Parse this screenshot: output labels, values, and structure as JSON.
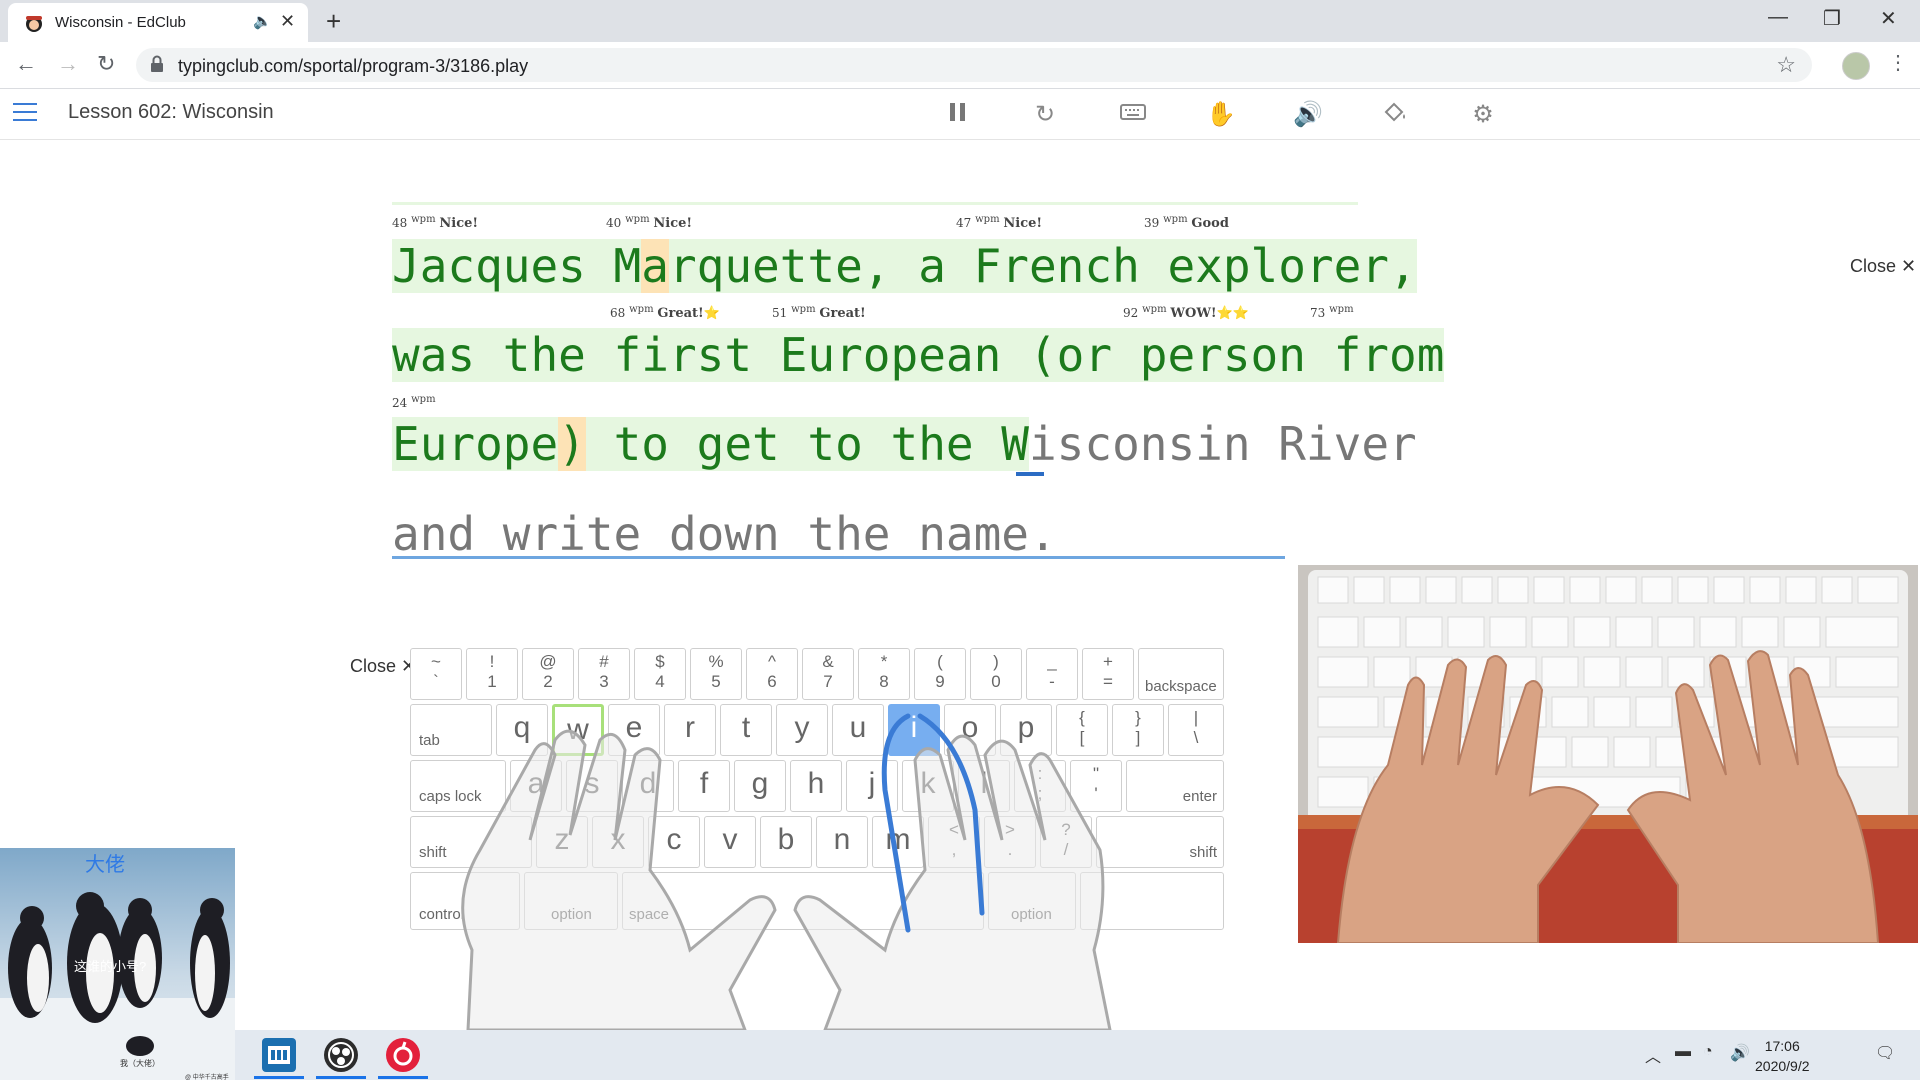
{
  "browser": {
    "tab_title": "Wisconsin - EdClub",
    "url": "typingclub.com/sportal/program-3/3186.play"
  },
  "app": {
    "lesson_title": "Lesson 602: Wisconsin",
    "close_label": "Close",
    "toolbar_icons": [
      "pause-icon",
      "restart-icon",
      "keyboard-icon",
      "hand-icon",
      "sound-icon",
      "theme-icon",
      "settings-icon"
    ]
  },
  "text": {
    "line1": {
      "wpm": [
        {
          "n": "48",
          "unit": "wpm",
          "rating": "Nice!"
        },
        {
          "n": "40",
          "unit": "wpm",
          "rating": "Nice!"
        },
        {
          "n": "47",
          "unit": "wpm",
          "rating": "Nice!"
        },
        {
          "n": "39",
          "unit": "wpm",
          "rating": "Good"
        }
      ],
      "seg1": "Jacques M",
      "err": "a",
      "seg2": "rquette, a French explorer,"
    },
    "line2": {
      "wpm": [
        {
          "n": "68",
          "unit": "wpm",
          "rating": "Great!⭐"
        },
        {
          "n": "51",
          "unit": "wpm",
          "rating": "Great!"
        },
        {
          "n": "92",
          "unit": "wpm",
          "rating": "WOW!⭐⭐"
        },
        {
          "n": "73",
          "unit": "wpm",
          "rating": ""
        }
      ],
      "text": "was the first European (or person from"
    },
    "line3": {
      "wpm": [
        {
          "n": "24",
          "unit": "wpm",
          "rating": ""
        }
      ],
      "seg1": "Europe",
      "err": ")",
      "seg2": " to get to the W",
      "untyped": "isconsin River"
    },
    "line4": "and write down the name."
  },
  "keyboard": {
    "row1": [
      {
        "top": "~",
        "bot": "`"
      },
      {
        "top": "!",
        "bot": "1"
      },
      {
        "top": "@",
        "bot": "2"
      },
      {
        "top": "#",
        "bot": "3"
      },
      {
        "top": "$",
        "bot": "4"
      },
      {
        "top": "%",
        "bot": "5"
      },
      {
        "top": "^",
        "bot": "6"
      },
      {
        "top": "&",
        "bot": "7"
      },
      {
        "top": "*",
        "bot": "8"
      },
      {
        "top": "(",
        "bot": "9"
      },
      {
        "top": ")",
        "bot": "0"
      },
      {
        "top": "_",
        "bot": "-"
      },
      {
        "top": "+",
        "bot": "="
      }
    ],
    "backspace": "backspace",
    "tab": "tab",
    "row2": [
      "q",
      "w",
      "e",
      "r",
      "t",
      "y",
      "u",
      "i",
      "o",
      "p"
    ],
    "row2_sym": [
      {
        "top": "{",
        "bot": "["
      },
      {
        "top": "}",
        "bot": "]"
      },
      {
        "top": "|",
        "bot": "\\"
      }
    ],
    "caps": "caps lock",
    "row3": [
      "a",
      "s",
      "d",
      "f",
      "g",
      "h",
      "j",
      "k",
      "l"
    ],
    "row3_sym": [
      {
        "top": ":",
        "bot": ";"
      },
      {
        "top": "\"",
        "bot": "'"
      }
    ],
    "enter": "enter",
    "shift": "shift",
    "row4": [
      "z",
      "x",
      "c",
      "v",
      "b",
      "n",
      "m"
    ],
    "row4_sym": [
      {
        "top": "<",
        "bot": ","
      },
      {
        "top": ">",
        "bot": "."
      },
      {
        "top": "?",
        "bot": "/"
      }
    ],
    "control": "control",
    "option": "option",
    "space": "space",
    "highlight_prev": "w",
    "highlight_next": "i"
  },
  "overlay": {
    "meme_title": "大佬",
    "meme_caption": "这谁的小号?",
    "meme_small": "我（大佬）",
    "meme_watermark": "@ 中华千古高手"
  },
  "taskbar": {
    "time": "17:06",
    "date": "2020/9/2"
  },
  "colors": {
    "typed_bg": "#e6f7e0",
    "typed_text": "#1c7a1c",
    "error_bg": "#fde3b6",
    "accent_blue": "#2b6cc4"
  }
}
